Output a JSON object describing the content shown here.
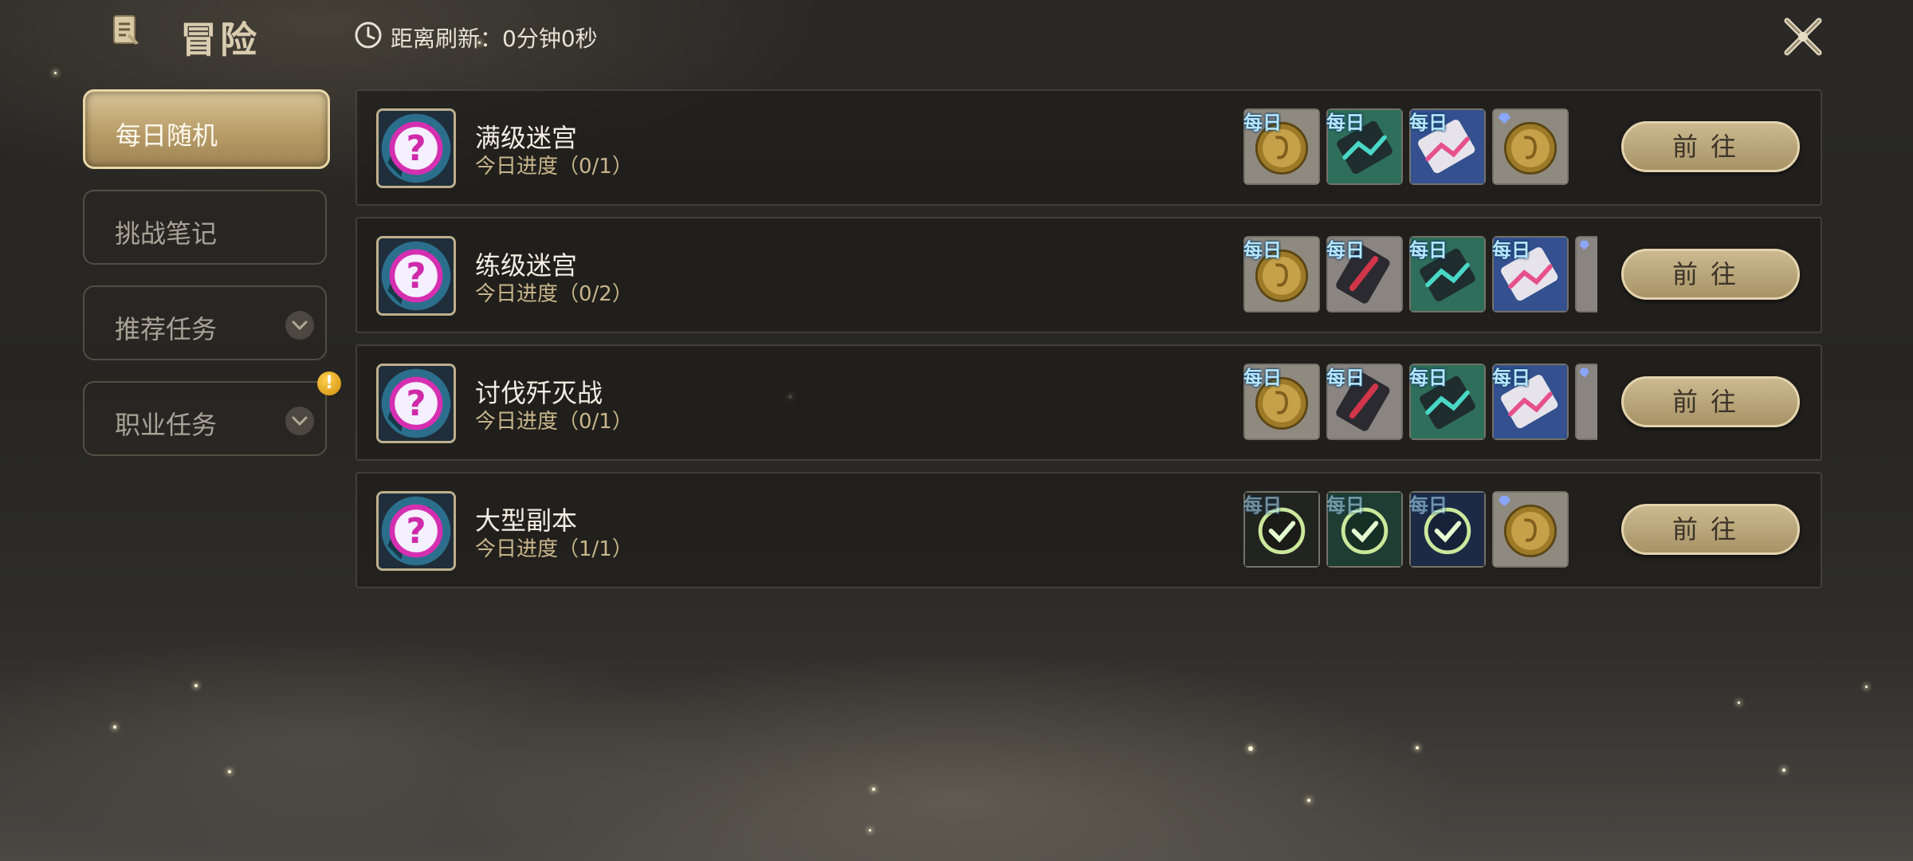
{
  "header": {
    "title": "冒险",
    "refresh_label": "距离刷新：",
    "refresh_time": "0分钟0秒",
    "title_icon": "quest-scroll-icon",
    "refresh_icon": "clock-icon",
    "close_icon": "close-x-icon"
  },
  "sidebar": {
    "items": [
      {
        "label": "每日随机",
        "active": true
      },
      {
        "label": "挑战笔记",
        "active": false
      },
      {
        "label": "推荐任务",
        "active": false,
        "expandable": true
      },
      {
        "label": "职业任务",
        "active": false,
        "expandable": true,
        "alert": "!"
      }
    ]
  },
  "tasks": [
    {
      "name": "满级迷宫",
      "progress": "今日进度（0/1）",
      "button": "前往",
      "rewards": [
        {
          "tag": "每日",
          "icon": "gold-coin-icon",
          "done": false
        },
        {
          "tag": "每日",
          "icon": "green-token-icon",
          "done": false
        },
        {
          "tag": "每日",
          "icon": "blue-token-icon",
          "done": false
        },
        {
          "tag": "",
          "icon": "gold-coin-gem-icon",
          "done": false
        }
      ]
    },
    {
      "name": "练级迷宫",
      "progress": "今日进度（0/2）",
      "button": "前往",
      "rewards": [
        {
          "tag": "每日",
          "icon": "gold-coin-icon",
          "done": false
        },
        {
          "tag": "每日",
          "icon": "red-token-icon",
          "done": false
        },
        {
          "tag": "每日",
          "icon": "green-token-icon",
          "done": false
        },
        {
          "tag": "每日",
          "icon": "blue-token-icon",
          "done": false
        },
        {
          "tag": "",
          "icon": "partial-reward-icon",
          "done": false
        }
      ]
    },
    {
      "name": "讨伐歼灭战",
      "progress": "今日进度（0/1）",
      "button": "前往",
      "rewards": [
        {
          "tag": "每日",
          "icon": "gold-coin-icon",
          "done": false
        },
        {
          "tag": "每日",
          "icon": "red-token-icon",
          "done": false
        },
        {
          "tag": "每日",
          "icon": "green-token-icon",
          "done": false
        },
        {
          "tag": "每日",
          "icon": "blue-token-icon",
          "done": false
        },
        {
          "tag": "",
          "icon": "partial-reward-icon",
          "done": false
        }
      ]
    },
    {
      "name": "大型副本",
      "progress": "今日进度（1/1）",
      "button": "前往",
      "rewards": [
        {
          "tag": "每日",
          "icon": "check-mark-icon",
          "done": true
        },
        {
          "tag": "每日",
          "icon": "check-mark-icon",
          "done": true
        },
        {
          "tag": "每日",
          "icon": "check-mark-icon",
          "done": true
        },
        {
          "tag": "",
          "icon": "gold-coin-gem-icon",
          "done": false
        }
      ]
    }
  ],
  "colors": {
    "accent_gold": "#cbb98f",
    "progress_text": "#c8b58a",
    "tag_blue": "#b8e6ff"
  }
}
